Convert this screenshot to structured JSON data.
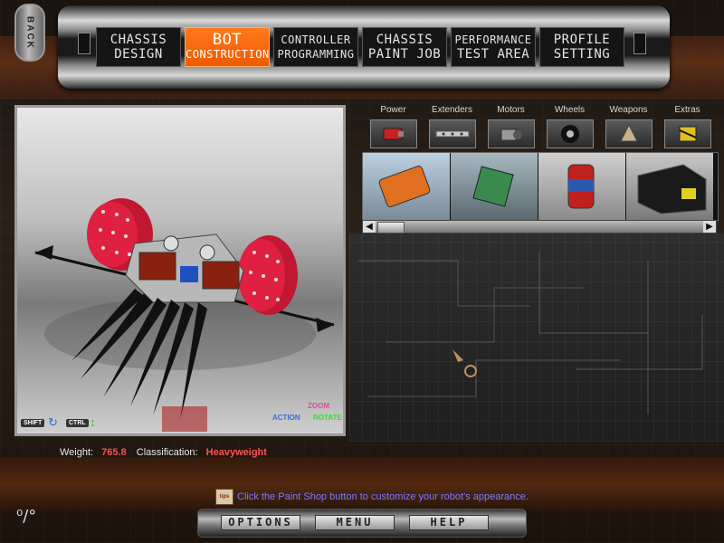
{
  "nav": {
    "back_label": "BACK",
    "tabs": [
      {
        "line1": "CHASSIS",
        "line2": "DESIGN",
        "active": false
      },
      {
        "line1": "BOT",
        "line2": "CONSTRUCTION",
        "active": true
      },
      {
        "line1": "CONTROLLER",
        "line2": "PROGRAMMING",
        "active": false
      },
      {
        "line1": "CHASSIS",
        "line2": "PAINT JOB",
        "active": false
      },
      {
        "line1": "PERFORMANCE",
        "line2": "TEST AREA",
        "active": false
      },
      {
        "line1": "PROFILE",
        "line2": "SETTING",
        "active": false
      }
    ]
  },
  "viewer": {
    "shift_hint": "SHIFT",
    "ctrl_hint": "CTRL",
    "zoom_label": "ZOOM",
    "action_label": "ACTION",
    "rotate_label": "ROTATE"
  },
  "parts": {
    "categories": [
      "Power",
      "Extenders",
      "Motors",
      "Wheels",
      "Weapons",
      "Extras"
    ],
    "items": [
      "battery-pack",
      "circuit-board",
      "power-canister",
      "power-box"
    ]
  },
  "stats": {
    "weight_label": "Weight:",
    "weight_value": "765.8",
    "class_label": "Classification:",
    "class_value": "Heavyweight"
  },
  "tip": {
    "icon_text": "tips",
    "text": "Click the Paint Shop button to customize your robot's appearance."
  },
  "footer": {
    "options_label": "OPTIONS",
    "menu_label": "MENU",
    "help_label": "HELP",
    "corner_mark": "⁰/°"
  }
}
